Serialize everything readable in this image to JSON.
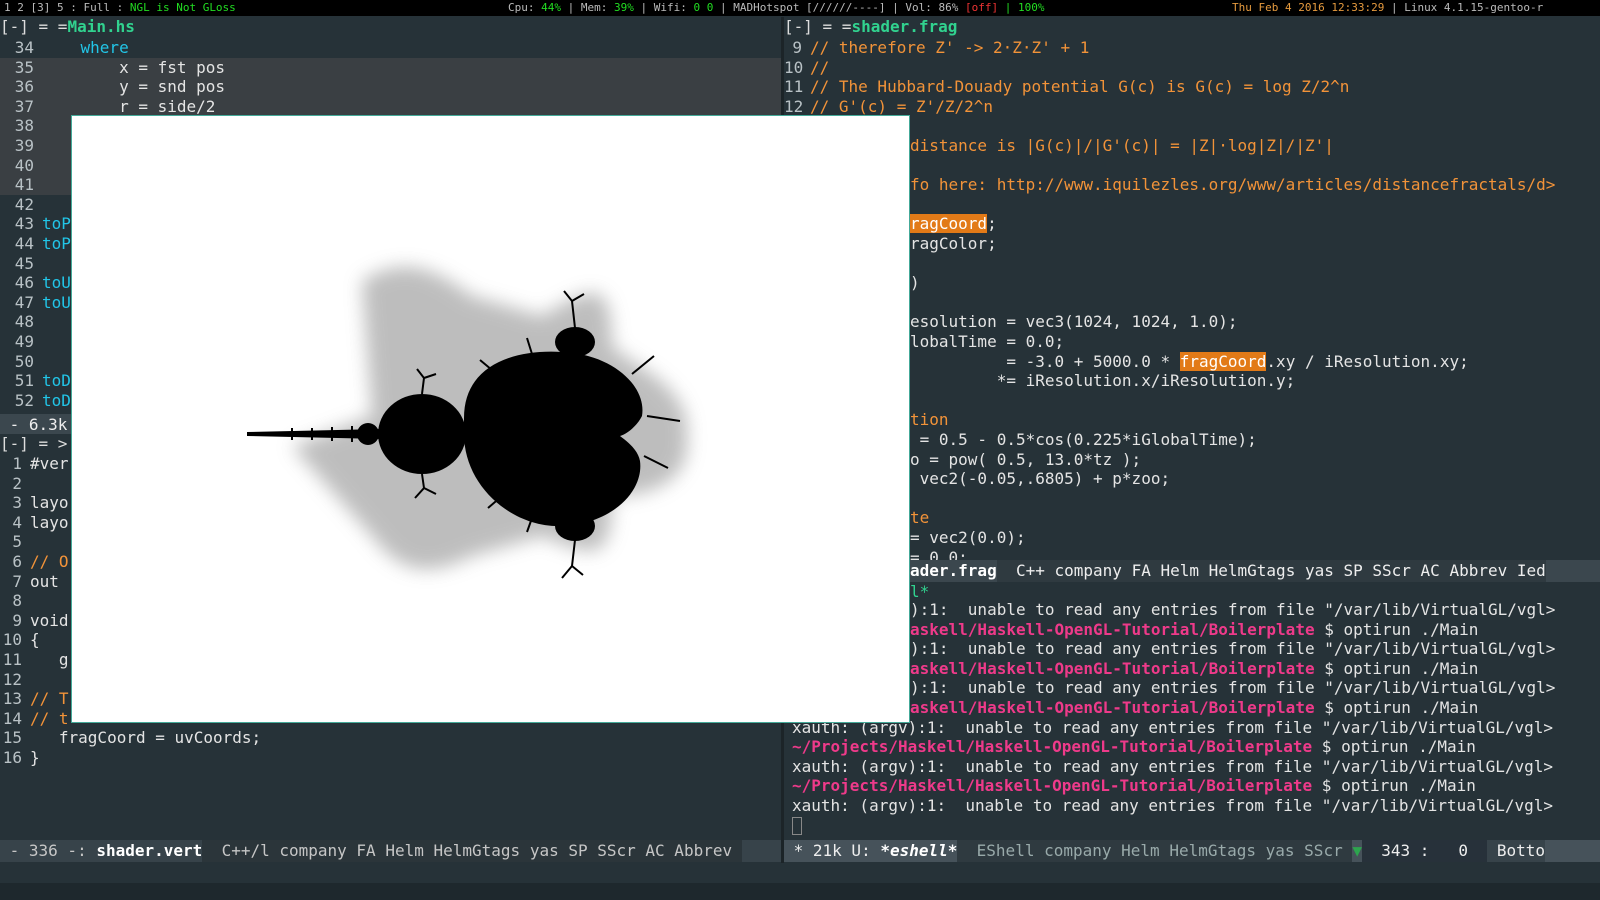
{
  "topbar": {
    "workspaces": "1 2 [3] 5 : Full : ",
    "window_title": "NGL is Not GLoss",
    "sys_prefix": "Cpu: ",
    "cpu": "44%",
    "mem_label": " | Mem: ",
    "mem": "39%",
    "wifi_label": " | Wifi: ",
    "wifi": "0 0",
    "network": " | MADHotspot [//////----] | Vol: 86% ",
    "vol_state": "[off]",
    "battery": " | 100%",
    "date": "Thu Feb  4 2016 12:33:29",
    "kernel": " | Linux 4.1.15-gentoo-r"
  },
  "main_hs": {
    "header_prefix": "[-] = =",
    "filename": "Main.hs",
    "lines": [
      {
        "n": "34",
        "t": "    where",
        "kw": true
      },
      {
        "n": "35",
        "t": "        x = fst pos"
      },
      {
        "n": "36",
        "t": "        y = snd pos"
      },
      {
        "n": "37",
        "t": "        r = side/2"
      },
      {
        "n": "38",
        "t": ""
      },
      {
        "n": "39",
        "t": ""
      },
      {
        "n": "40",
        "t": ""
      },
      {
        "n": "41",
        "t": ""
      },
      {
        "n": "42",
        "t": ""
      },
      {
        "n": "43",
        "t": "toP",
        "kw": true
      },
      {
        "n": "44",
        "t": "toP",
        "kw": true
      },
      {
        "n": "45",
        "t": ""
      },
      {
        "n": "46",
        "t": "toU",
        "kw": true
      },
      {
        "n": "47",
        "t": "toU",
        "kw": true
      },
      {
        "n": "48",
        "t": ""
      },
      {
        "n": "49",
        "t": ""
      },
      {
        "n": "50",
        "t": ""
      },
      {
        "n": "51",
        "t": "toD",
        "kw": true
      },
      {
        "n": "52",
        "t": "toD",
        "kw": true
      }
    ],
    "modeline": " - 6.3k"
  },
  "shader_vert": {
    "header": "[-] = >",
    "lines": [
      {
        "n": "1",
        "t": "#ver"
      },
      {
        "n": "2",
        "t": ""
      },
      {
        "n": "3",
        "t": "layo"
      },
      {
        "n": "4",
        "t": "layo"
      },
      {
        "n": "5",
        "t": ""
      },
      {
        "n": "6",
        "t": "// O",
        "cm": true
      },
      {
        "n": "7",
        "t": "out"
      },
      {
        "n": "8",
        "t": ""
      },
      {
        "n": "9",
        "t": "void"
      },
      {
        "n": "10",
        "t": "{"
      },
      {
        "n": "11",
        "t": "   g"
      },
      {
        "n": "12",
        "t": ""
      },
      {
        "n": "13",
        "t": "// T",
        "cm": true
      },
      {
        "n": "14",
        "t": "// t",
        "cm": true
      },
      {
        "n": "15",
        "t": "   fragCoord = uvCoords;"
      },
      {
        "n": "16",
        "t": "}"
      }
    ],
    "modeline_size": " - 336 -: ",
    "modeline_file": "shader.vert",
    "modeline_modes": "  C++/l company FA Helm HelmGtags yas SP SScr AC Abbrev "
  },
  "shader_frag": {
    "header_prefix": "[-] = =",
    "filename": "shader.frag",
    "lines": [
      {
        "n": "9",
        "t": "// therefore Z' -> 2·Z·Z' + 1",
        "cm": true
      },
      {
        "n": "10",
        "t": "//",
        "cm": true
      },
      {
        "n": "11",
        "t": "// The Hubbard-Douady potential G(c) is G(c) = log Z/2^n",
        "cm": true
      },
      {
        "n": "12",
        "t": "// G'(c) = Z'/Z/2^n",
        "cm": true
      }
    ],
    "visible_tail": [
      {
        "y": 0,
        "t": "",
        "c": ""
      },
      {
        "y": 1,
        "t": "distance is |G(c)|/|G'(c)| = |Z|·log|Z|/|Z'|",
        "c": "cm"
      },
      {
        "y": 2,
        "t": "",
        "c": ""
      },
      {
        "y": 3,
        "t": "fo here: http://www.iquilezles.org/www/articles/distancefractals/d>",
        "c": "cm"
      },
      {
        "y": 4,
        "t": "",
        "c": ""
      },
      {
        "y": 5,
        "t": "ragCoord",
        "c": "fc",
        "after": ";"
      },
      {
        "y": 6,
        "t": "ragColor;",
        "c": ""
      },
      {
        "y": 7,
        "t": "",
        "c": ""
      },
      {
        "y": 8,
        "t": ")",
        "c": ""
      },
      {
        "y": 9,
        "t": "",
        "c": ""
      },
      {
        "y": 10,
        "t": "esolution = vec3(1024, 1024, 1.0);",
        "c": ""
      },
      {
        "y": 11,
        "t": "lobalTime = 0.0;",
        "c": ""
      },
      {
        "y": 12,
        "t": "          = -3.0 + 5000.0 * ",
        "c": "",
        "hl": "fragCoord",
        "after": ".xy / iResolution.xy;"
      },
      {
        "y": 13,
        "t": "         *= iResolution.x/iResolution.y;",
        "c": ""
      },
      {
        "y": 14,
        "t": "",
        "c": ""
      },
      {
        "y": 15,
        "t": "tion",
        "c": "cm"
      },
      {
        "y": 16,
        "t": " = 0.5 - 0.5*cos(0.225*iGlobalTime);",
        "c": ""
      },
      {
        "y": 17,
        "t": "o = pow( 0.5, 13.0*tz );",
        "c": ""
      },
      {
        "y": 18,
        "t": " vec2(-0.05,.6805) + p*zoo;",
        "c": ""
      },
      {
        "y": 19,
        "t": "",
        "c": ""
      },
      {
        "y": 20,
        "t": "te",
        "c": "cm"
      },
      {
        "y": 21,
        "t": "= vec2(0.0);",
        "c": ""
      },
      {
        "y": 22,
        "t": "= 0.0;",
        "c": ""
      }
    ],
    "modeline_file": "ader.frag",
    "modeline_modes": "  C++ company FA Helm HelmGtags yas SP SScr AC Abbrev Ied"
  },
  "eshell": {
    "star_line": "l*",
    "lines": [
      {
        "t": "):1:  unable to read any entries from file \"/var/lib/VirtualGL/vgl>",
        "p": false
      },
      {
        "t": "askell/Haskell-OpenGL-Tutorial/Boilerplate",
        "p": true,
        "cmd": " $ optirun ./Main"
      },
      {
        "t": "):1:  unable to read any entries from file \"/var/lib/VirtualGL/vgl>",
        "p": false
      },
      {
        "t": "askell/Haskell-OpenGL-Tutorial/Boilerplate",
        "p": true,
        "cmd": " $ optirun ./Main"
      },
      {
        "t": "):1:  unable to read any entries from file \"/var/lib/VirtualGL/vgl>",
        "p": false
      },
      {
        "t": "askell/Haskell-OpenGL-Tutorial/Boilerplate",
        "p": true,
        "cmd": " $ optirun ./Main"
      },
      {
        "t": "xauth: (argv):1:  unable to read any entries from file \"/var/lib/VirtualGL/vgl>",
        "p": false
      },
      {
        "t": "~/Projects/Haskell/Haskell-OpenGL-Tutorial/Boilerplate",
        "p": true,
        "cmd": " $ optirun ./Main"
      },
      {
        "t": "xauth: (argv):1:  unable to read any entries from file \"/var/lib/VirtualGL/vgl>",
        "p": false
      },
      {
        "t": "~/Projects/Haskell/Haskell-OpenGL-Tutorial/Boilerplate",
        "p": true,
        "cmd": " $ optirun ./Main"
      },
      {
        "t": "xauth: (argv):1:  unable to read any entries from file \"/var/lib/VirtualGL/vgl>",
        "p": false
      }
    ],
    "modeline_left": " * 21k U: ",
    "modeline_buffer": "*eshell*",
    "modeline_modes": "  EShell company Helm HelmGtags yas SScr ",
    "modeline_pos": "  343 :   0  ",
    "modeline_end": " Botto"
  },
  "colors": {
    "background": "#263238",
    "accent": "#31d28f",
    "comment": "#f29339",
    "keyword": "#22c5e7",
    "highlight": "#e27a17"
  }
}
